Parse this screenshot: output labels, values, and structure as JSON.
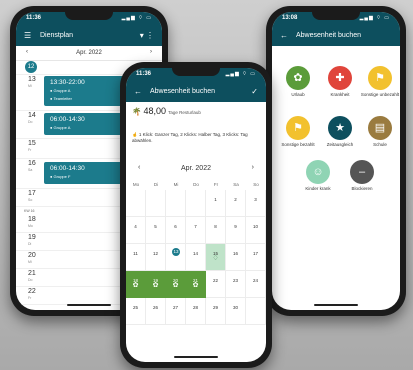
{
  "phone1": {
    "status_time": "11:36",
    "status_icons": "▂▄▆ ⌔ ▭",
    "title": "Dienstplan",
    "month": "Apr. 2022",
    "days": [
      {
        "num": "12",
        "sub": "Di",
        "today": true
      },
      {
        "num": "13",
        "sub": "Mi",
        "shift_time": "13:30-22:00",
        "groups": [
          "Gruppe A",
          "Teamleiter"
        ]
      },
      {
        "num": "14",
        "sub": "Do",
        "shift_time": "06:00-14:30",
        "groups": [
          "Gruppe A"
        ]
      },
      {
        "num": "15",
        "sub": "Fr"
      },
      {
        "num": "16",
        "sub": "Sa",
        "shift_time": "06:00-14:30",
        "groups": [
          "Gruppe F"
        ]
      },
      {
        "num": "17",
        "sub": "So"
      },
      {
        "num": "18",
        "sub": "Mo"
      },
      {
        "num": "19",
        "sub": "Di"
      },
      {
        "num": "20",
        "sub": "Mi"
      },
      {
        "num": "21",
        "sub": "Do"
      },
      {
        "num": "22",
        "sub": "Fr"
      }
    ],
    "kw": "KW 16"
  },
  "phone2": {
    "status_time": "11:36",
    "status_icons": "▂▄▆ ⌔ ▭",
    "title": "Abwesenheit buchen",
    "days_left_value": "48,00",
    "days_left_label": "Tage Resturlaub",
    "hint": "1 Klick: Ganzer Tag, 2 Klicks: Halber Tag, 3 Klicks: Tag abwählen.",
    "month": "Apr. 2022",
    "weekdays": [
      "Mo",
      "Di",
      "Mi",
      "Do",
      "Fr",
      "Sa",
      "So"
    ],
    "week_rows": [
      [
        "",
        "",
        "",
        "",
        "1",
        "2",
        "3"
      ],
      [
        "4",
        "5",
        "6",
        "7",
        "8",
        "9",
        "10"
      ],
      [
        "11",
        "12",
        "13",
        "14",
        "15",
        "16",
        "17"
      ],
      [
        "18",
        "19",
        "20",
        "21",
        "22",
        "23",
        "24"
      ],
      [
        "25",
        "26",
        "27",
        "28",
        "29",
        "30",
        ""
      ]
    ]
  },
  "phone3": {
    "status_time": "13:08",
    "status_icons": "▂▄▆ ⌔ ▭",
    "title": "Abwesenheit buchen",
    "types": [
      {
        "label": "Urlaub",
        "color": "#5b9c3a",
        "glyph": "✿"
      },
      {
        "label": "Krankheit",
        "color": "#e0453b",
        "glyph": "✚"
      },
      {
        "label": "Sonstige unbezahlt",
        "color": "#f2c12e",
        "glyph": "⚑"
      },
      {
        "label": "Sonstige bezahlt",
        "color": "#f2c12e",
        "glyph": "⚑"
      },
      {
        "label": "Zeitausgleich",
        "color": "#0d4f5e",
        "glyph": "★"
      },
      {
        "label": "Schule",
        "color": "#9a7b3f",
        "glyph": "▤"
      },
      {
        "label": "Kinder krank",
        "color": "#8fd4b4",
        "glyph": "☺"
      },
      {
        "label": "Blockieren",
        "color": "#555555",
        "glyph": "–"
      }
    ]
  }
}
